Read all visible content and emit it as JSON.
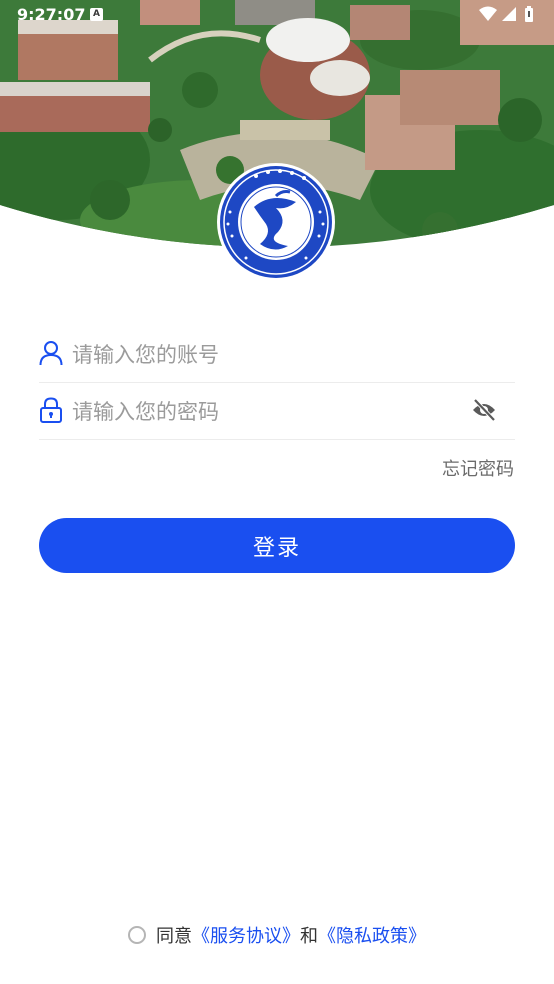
{
  "status_bar": {
    "time": "9:27:07",
    "notification_letter": "A",
    "icons": [
      "wifi-icon",
      "signal-icon",
      "battery-icon"
    ]
  },
  "banner": {
    "image": "campus-aerial-photo",
    "logo": "school-seal-logo"
  },
  "form": {
    "account_placeholder": "请输入您的账号",
    "password_placeholder": "请输入您的密码",
    "account_icon": "user-icon",
    "password_icon": "lock-icon",
    "visibility_icon": "eye-off-icon"
  },
  "forgot_password": "忘记密码",
  "login_button": "登录",
  "agreement": {
    "prefix": "同意",
    "service_link": "《服务协议》",
    "conjunction": "和",
    "privacy_link": "《隐私政策》"
  },
  "colors": {
    "accent": "#1a4ff0",
    "placeholder": "#9b9b9b"
  }
}
